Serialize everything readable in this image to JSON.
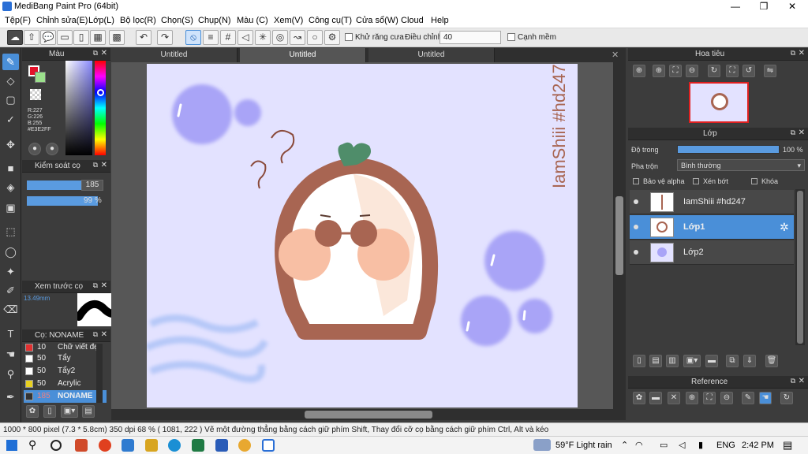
{
  "window": {
    "title": "MediBang Paint Pro (64bit)",
    "minimize": "—",
    "maximize": "❐",
    "close": "✕"
  },
  "menu": [
    "Tệp(F)",
    "Chỉnh sửa(E)",
    "Lớp(L)",
    "Bộ lọc(R)",
    "Chọn(S)",
    "Chụp(N)",
    "Màu (C)",
    "Xem(V)",
    "Công cụ(T)",
    "Cửa sổ(W)",
    "Cloud",
    "Help"
  ],
  "toolbar": {
    "antialias_label": "Khử răng cưa",
    "adjust_label": "Điều chỉnh",
    "adjust_value": "40",
    "smooth_label": "Cạnh mềm"
  },
  "tabs": [
    "Untitled",
    "Untitled",
    "Untitled"
  ],
  "color_panel": {
    "title": "Màu",
    "r": "R:227",
    "g": "G:226",
    "b": "B:255",
    "hex": "#E3E2FF",
    "primary": "#e3122a",
    "secondary": "#9be08c"
  },
  "brush_control": {
    "title": "Kiểm soát cọ",
    "size": "185",
    "opacity": "99 %"
  },
  "brush_preview": {
    "title": "Xem trước cọ",
    "size_text": "13.49mm"
  },
  "brush_list": {
    "title": "Cọ: NONAME",
    "items": [
      {
        "size": "10",
        "name": "Chữ viết đẹ",
        "color": "#e23030"
      },
      {
        "size": "50",
        "name": "Tẩy",
        "color": "#ffffff"
      },
      {
        "size": "50",
        "name": "Tẩy2",
        "color": "#ffffff"
      },
      {
        "size": "50",
        "name": "Acrylic",
        "color": "#e8d020"
      },
      {
        "size": "185",
        "name": "NONAME",
        "color": "#333333"
      }
    ]
  },
  "canvas": {
    "bg": "#e3e2ff",
    "watermark": "IamShiii #hd247"
  },
  "navigator": {
    "title": "Hoa tiêu"
  },
  "layers": {
    "title": "Lớp",
    "opacity_label": "Độ trong",
    "opacity_value": "100 %",
    "blend_label": "Pha trộn",
    "blend_value": "Bình thường",
    "alpha_label": "Bảo vệ alpha",
    "clip_label": "Xén bớt",
    "lock_label": "Khóa",
    "items": [
      {
        "name": "IamShiii #hd247"
      },
      {
        "name": "Lớp1"
      },
      {
        "name": "Lớp2"
      }
    ]
  },
  "reference": {
    "title": "Reference"
  },
  "status": {
    "text": "1000 * 800 pixel   (7.3 * 5.8cm)   350 dpi   68 %   ( 1081, 222 )   Vẽ một đường thẳng bằng cách giữ phím Shift, Thay đổi cỡ cọ bằng cách giữ phím Ctrl, Alt và kéo"
  },
  "taskbar": {
    "weather": "59°F  Light rain",
    "lang": "ENG",
    "time": "2:42 PM"
  }
}
